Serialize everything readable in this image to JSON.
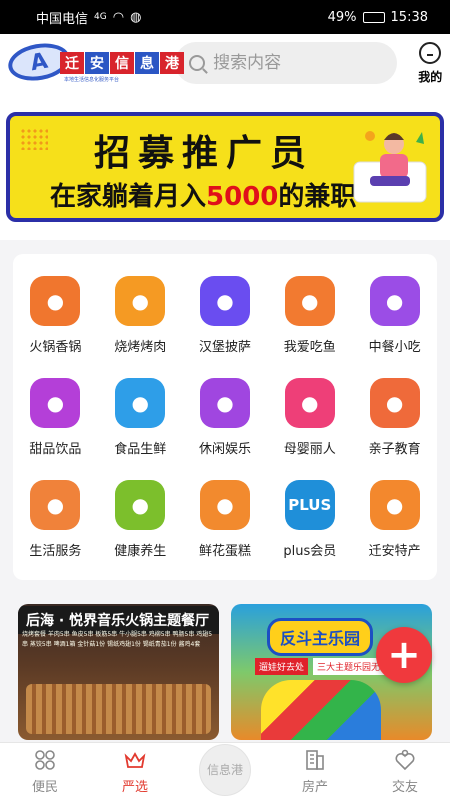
{
  "statusbar": {
    "carrier": "中国电信",
    "network": "4G",
    "battery": "49%",
    "time": "15:38"
  },
  "header": {
    "logo_chars": [
      "迁",
      "安",
      "信",
      "息",
      "港"
    ],
    "logo_sub": "本地生活信息化服务平台",
    "search_placeholder": "搜索内容",
    "me_label": "我的"
  },
  "banner": {
    "title": "招募推广员",
    "sub_before": "在家躺着月入",
    "sub_highlight": "5000",
    "sub_after": "的兼职"
  },
  "categories": [
    {
      "label": "火锅香锅",
      "icon": "hotpot-icon",
      "color": "#f0762e"
    },
    {
      "label": "烧烤烤肉",
      "icon": "bbq-icon",
      "color": "#f59a23"
    },
    {
      "label": "汉堡披萨",
      "icon": "burger-icon",
      "color": "#6a4df0"
    },
    {
      "label": "我爱吃鱼",
      "icon": "fish-icon",
      "color": "#f27a30"
    },
    {
      "label": "中餐小吃",
      "icon": "dish-icon",
      "color": "#9b4de6"
    },
    {
      "label": "甜品饮品",
      "icon": "cup-icon",
      "color": "#b43fd8"
    },
    {
      "label": "食品生鲜",
      "icon": "crab-icon",
      "color": "#2e9ee8"
    },
    {
      "label": "休闲娱乐",
      "icon": "leisure-icon",
      "color": "#a046e0"
    },
    {
      "label": "母婴丽人",
      "icon": "woman-icon",
      "color": "#ee3f78"
    },
    {
      "label": "亲子教育",
      "icon": "family-icon",
      "color": "#ef6a3a"
    },
    {
      "label": "生活服务",
      "icon": "house-icon",
      "color": "#f0823a"
    },
    {
      "label": "健康养生",
      "icon": "teapot-icon",
      "color": "#7cbf2c"
    },
    {
      "label": "鲜花蛋糕",
      "icon": "flower-icon",
      "color": "#f28a2e"
    },
    {
      "label": "plus会员",
      "icon": "plus-badge-icon",
      "color": "#1f8fd9",
      "text": "PLUS"
    },
    {
      "label": "迁安特产",
      "icon": "fruit-icon",
      "color": "#f3882d"
    }
  ],
  "cards": [
    {
      "title": "后海 · 悦界音乐火锅主题餐厅",
      "menu": "烧烤套餐 羊肉5串 鱼皮5串 板筋5串 牛小腿5串 鸡柳5串 鸭肠5串 鸡翅5串 蒸饺5串 啤酒1箱 金针菇1份 锡纸鸡翅1份 锡纸青茄1份 酱鸡4套"
    },
    {
      "sign": "反斗主乐园",
      "tag1": "遛娃好去处",
      "tag2": "三大主题乐园无限玩"
    }
  ],
  "fab": "+",
  "tabs": [
    {
      "label": "便民",
      "icon": "grid-icon",
      "active": false
    },
    {
      "label": "严选",
      "icon": "crown-icon",
      "active": true
    },
    {
      "label": "信息港",
      "center": true
    },
    {
      "label": "房产",
      "icon": "building-icon",
      "active": false
    },
    {
      "label": "交友",
      "icon": "hearts-icon",
      "active": false
    }
  ]
}
